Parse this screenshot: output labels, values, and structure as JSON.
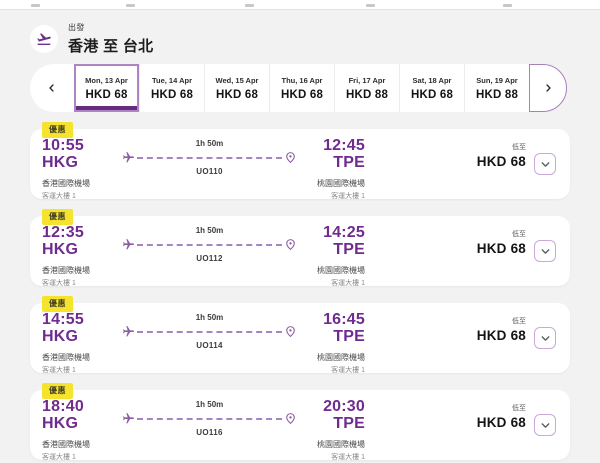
{
  "header": {
    "label": "出發",
    "title": "香港 至 台北",
    "icon": "flight-takeoff"
  },
  "date_carousel": {
    "prev_icon": "chevron-left",
    "next_icon": "chevron-right",
    "days": [
      {
        "date": "Mon, 13 Apr",
        "price": "HKD 68",
        "selected": true
      },
      {
        "date": "Tue, 14 Apr",
        "price": "HKD 68",
        "selected": false
      },
      {
        "date": "Wed, 15 Apr",
        "price": "HKD 68",
        "selected": false
      },
      {
        "date": "Thu, 16 Apr",
        "price": "HKD 68",
        "selected": false
      },
      {
        "date": "Fri, 17 Apr",
        "price": "HKD 88",
        "selected": false
      },
      {
        "date": "Sat, 18 Apr",
        "price": "HKD 68",
        "selected": false
      },
      {
        "date": "Sun, 19 Apr",
        "price": "HKD 88",
        "selected": false
      }
    ]
  },
  "flights": [
    {
      "badge": "優惠",
      "dep_time": "10:55",
      "dep_code": "HKG",
      "dep_airport": "香港國際機場",
      "dep_terminal": "客運大樓 1",
      "duration": "1h 50m",
      "flight_no": "UO110",
      "arr_time": "12:45",
      "arr_code": "TPE",
      "arr_airport": "桃園國際機場",
      "arr_terminal": "客運大樓 1",
      "price_label": "低至",
      "price": "HKD 68"
    },
    {
      "badge": "優惠",
      "dep_time": "12:35",
      "dep_code": "HKG",
      "dep_airport": "香港國際機場",
      "dep_terminal": "客運大樓 1",
      "duration": "1h 50m",
      "flight_no": "UO112",
      "arr_time": "14:25",
      "arr_code": "TPE",
      "arr_airport": "桃園國際機場",
      "arr_terminal": "客運大樓 1",
      "price_label": "低至",
      "price": "HKD 68"
    },
    {
      "badge": "優惠",
      "dep_time": "14:55",
      "dep_code": "HKG",
      "dep_airport": "香港國際機場",
      "dep_terminal": "客運大樓 1",
      "duration": "1h 50m",
      "flight_no": "UO114",
      "arr_time": "16:45",
      "arr_code": "TPE",
      "arr_airport": "桃園國際機場",
      "arr_terminal": "客運大樓 1",
      "price_label": "低至",
      "price": "HKD 68"
    },
    {
      "badge": "優惠",
      "dep_time": "18:40",
      "dep_code": "HKG",
      "dep_airport": "香港國際機場",
      "dep_terminal": "客運大樓 1",
      "duration": "1h 50m",
      "flight_no": "UO116",
      "arr_time": "20:30",
      "arr_code": "TPE",
      "arr_airport": "桃園國際機場",
      "arr_terminal": "客運大樓 1",
      "price_label": "低至",
      "price": "HKD 68"
    }
  ],
  "icons": {
    "route_start": "plane-right",
    "route_end": "location-pin",
    "expand": "chevron-down"
  },
  "colors": {
    "accent_purple": "#6F2B8D",
    "underline_purple": "#662A80",
    "light_purple_border": "#A97FBC",
    "badge_yellow": "#F5E32E",
    "page_background": "#F3F2F2"
  }
}
